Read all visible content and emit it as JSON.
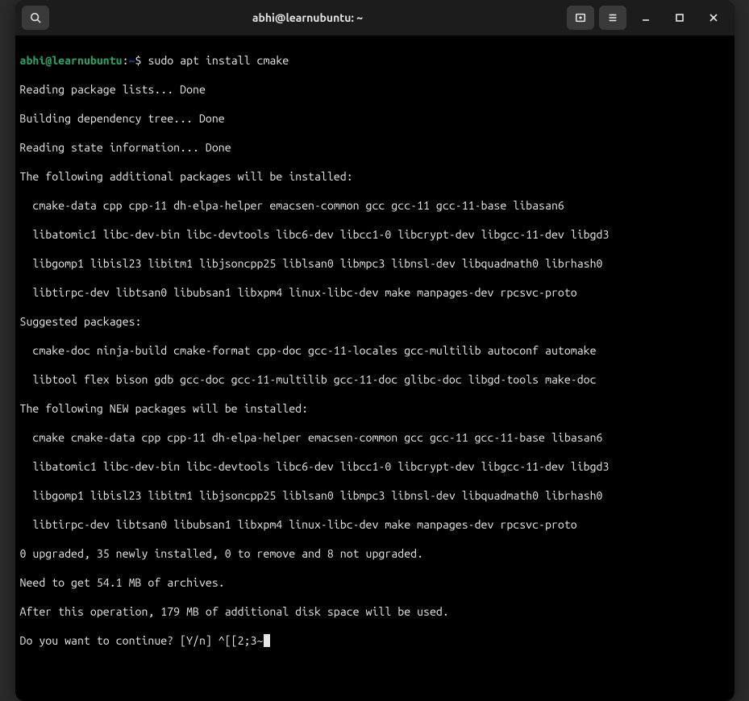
{
  "titlebar": {
    "title": "abhi@learnubuntu: ~"
  },
  "prompt": {
    "user_host": "abhi@learnubuntu",
    "separator": ":",
    "path": "~",
    "symbol": "$",
    "command": "sudo apt install cmake"
  },
  "output": {
    "l0": "Reading package lists... Done",
    "l1": "Building dependency tree... Done",
    "l2": "Reading state information... Done",
    "l3": "The following additional packages will be installed:",
    "l4": "  cmake-data cpp cpp-11 dh-elpa-helper emacsen-common gcc gcc-11 gcc-11-base libasan6",
    "l5": "  libatomic1 libc-dev-bin libc-devtools libc6-dev libcc1-0 libcrypt-dev libgcc-11-dev libgd3",
    "l6": "  libgomp1 libisl23 libitm1 libjsoncpp25 liblsan0 libmpc3 libnsl-dev libquadmath0 librhash0",
    "l7": "  libtirpc-dev libtsan0 libubsan1 libxpm4 linux-libc-dev make manpages-dev rpcsvc-proto",
    "l8": "Suggested packages:",
    "l9": "  cmake-doc ninja-build cmake-format cpp-doc gcc-11-locales gcc-multilib autoconf automake",
    "l10": "  libtool flex bison gdb gcc-doc gcc-11-multilib gcc-11-doc glibc-doc libgd-tools make-doc",
    "l11": "The following NEW packages will be installed:",
    "l12": "  cmake cmake-data cpp cpp-11 dh-elpa-helper emacsen-common gcc gcc-11 gcc-11-base libasan6",
    "l13": "  libatomic1 libc-dev-bin libc-devtools libc6-dev libcc1-0 libcrypt-dev libgcc-11-dev libgd3",
    "l14": "  libgomp1 libisl23 libitm1 libjsoncpp25 liblsan0 libmpc3 libnsl-dev libquadmath0 librhash0",
    "l15": "  libtirpc-dev libtsan0 libubsan1 libxpm4 linux-libc-dev make manpages-dev rpcsvc-proto",
    "l16": "0 upgraded, 35 newly installed, 0 to remove and 8 not upgraded.",
    "l17": "Need to get 54.1 MB of archives.",
    "l18": "After this operation, 179 MB of additional disk space will be used.",
    "l19": "Do you want to continue? [Y/n] ^[[2;3~"
  }
}
